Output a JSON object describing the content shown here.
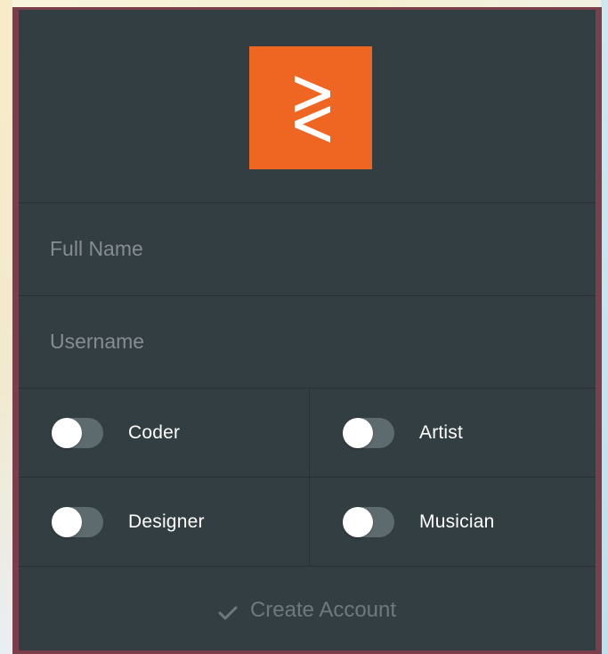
{
  "form": {
    "logo_icon": "double-chevron-logo-icon",
    "full_name": {
      "value": "",
      "placeholder": "Full Name"
    },
    "username": {
      "value": "",
      "placeholder": "Username"
    },
    "roles": [
      {
        "label": "Coder",
        "checked": false
      },
      {
        "label": "Artist",
        "checked": false
      },
      {
        "label": "Designer",
        "checked": false
      },
      {
        "label": "Musician",
        "checked": false
      }
    ],
    "submit": {
      "label": "Create Account",
      "icon": "check-icon"
    }
  },
  "colors": {
    "card_background": "#333e42",
    "card_border": "#7b3f4b",
    "logo_accent": "#ef6522",
    "toggle_track": "#5d6b6f",
    "toggle_knob": "#ffffff"
  }
}
